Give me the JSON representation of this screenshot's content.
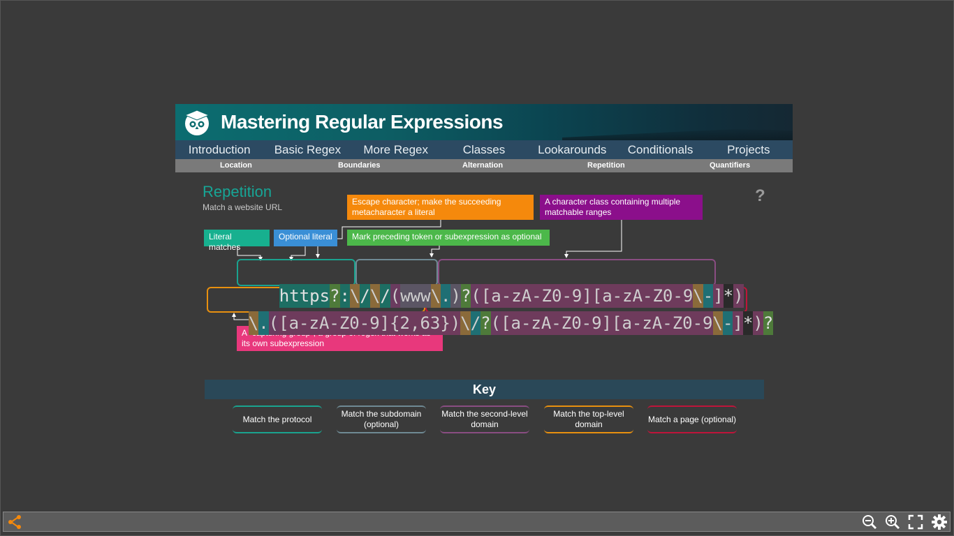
{
  "header": {
    "title": "Mastering Regular Expressions",
    "nav": [
      "Introduction",
      "Basic Regex",
      "More Regex",
      "Classes",
      "Lookarounds",
      "Conditionals",
      "Projects"
    ],
    "subnav": [
      "Location",
      "Boundaries",
      "Alternation",
      "Repetition",
      "Quantifiers"
    ]
  },
  "section": {
    "title": "Repetition",
    "subtitle": "Match a website URL",
    "help": "?"
  },
  "callouts": {
    "escape": "Escape character; make the succeeding metacharacter a literal",
    "charclass": "A character class containing multiple matchable ranges",
    "literal": "Literal matches",
    "optional_literal": "Optional literal",
    "optional": "Mark preceding token or subexpression as optional",
    "group": "A \"capturing group\"; a group of regex that works as its own subexpression"
  },
  "regex": {
    "line1": "https?:\\/\\/(www\\.)?([a-zA-Z0-9][a-zA-Z0-9\\-]*)",
    "line2": "\\.([a-zA-Z0-9]{2,63})\\/?([a-zA-Z0-9][a-zA-Z0-9\\-]*)?"
  },
  "key": {
    "title": "Key",
    "items": [
      {
        "label": "Match the protocol",
        "color": "#1aa38f"
      },
      {
        "label": "Match the subdomain (optional)",
        "color": "#6f8a94"
      },
      {
        "label": "Match the second-level domain",
        "color": "#8a4d82"
      },
      {
        "label": "Match the top-level domain",
        "color": "#e8900f"
      },
      {
        "label": "Match a page (optional)",
        "color": "#c0143a"
      }
    ]
  },
  "colors": {
    "escape": "#f5890c",
    "charclass": "#8b0f8b",
    "literal": "#17b08f",
    "optional_literal": "#3a8fd6",
    "optional": "#4cb84a",
    "group": "#e8387c"
  },
  "toolbar": {
    "icons": [
      "share-icon",
      "zoom-out-icon",
      "zoom-in-icon",
      "fullscreen-icon",
      "settings-icon"
    ]
  }
}
